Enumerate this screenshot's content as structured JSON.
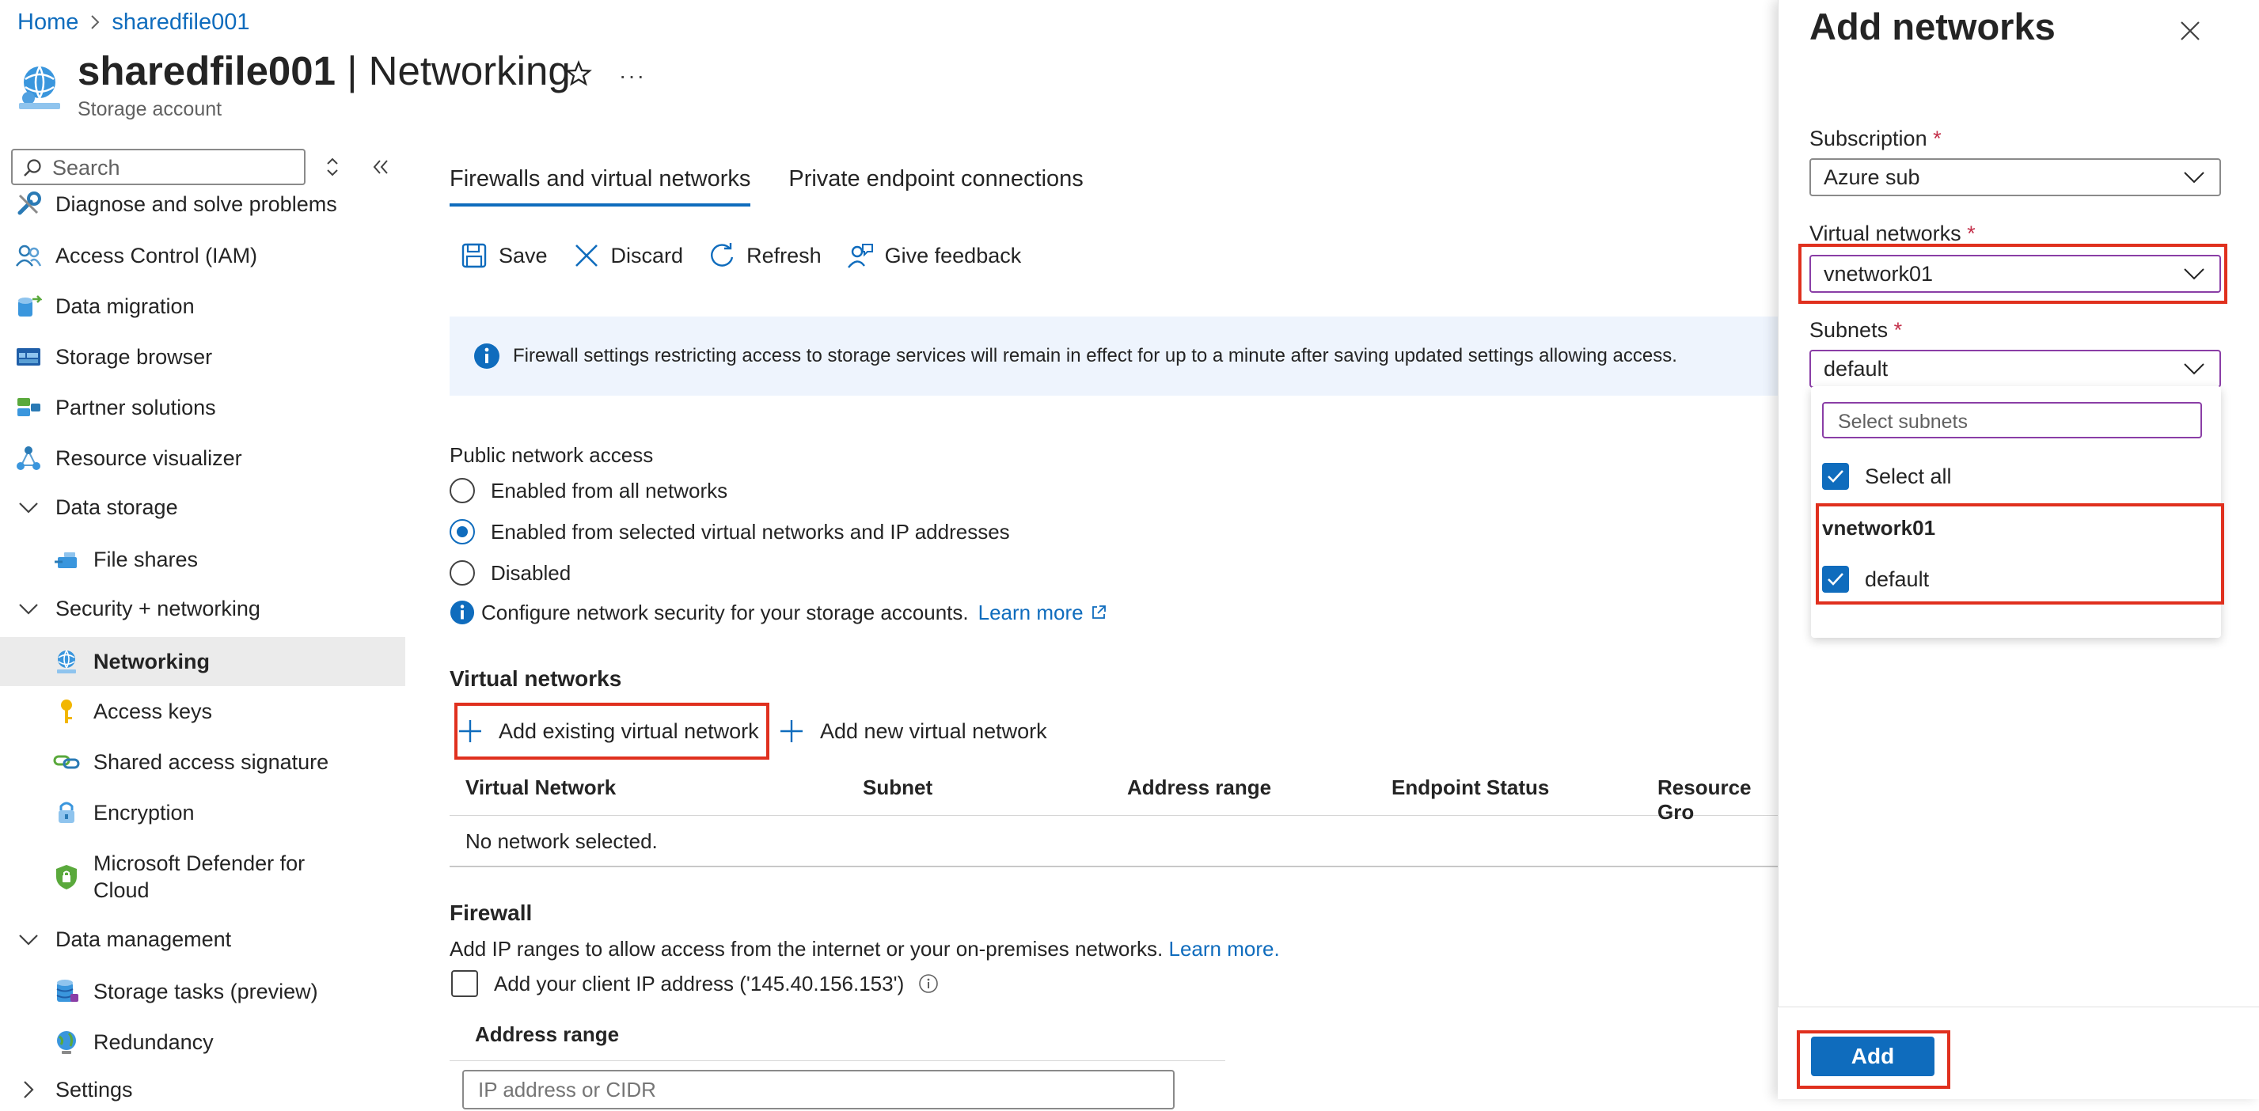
{
  "breadcrumb": {
    "home": "Home",
    "resource": "sharedfile001"
  },
  "header": {
    "resource_name": "sharedfile001",
    "separator": " | ",
    "page": "Networking",
    "subtitle": "Storage account",
    "more": "···"
  },
  "sidebar": {
    "search_placeholder": "Search",
    "items": [
      {
        "label": "Diagnose and solve problems",
        "icon": "wrench-icon"
      },
      {
        "label": "Access Control (IAM)",
        "icon": "people-icon"
      },
      {
        "label": "Data migration",
        "icon": "migration-icon"
      },
      {
        "label": "Storage browser",
        "icon": "storage-browser-icon"
      },
      {
        "label": "Partner solutions",
        "icon": "partner-icon"
      },
      {
        "label": "Resource visualizer",
        "icon": "visualizer-icon"
      },
      {
        "label": "Data storage",
        "icon": "chevron-down-icon"
      },
      {
        "label": "File shares",
        "icon": "file-share-icon"
      },
      {
        "label": "Security + networking",
        "icon": "chevron-down-icon"
      },
      {
        "label": "Networking",
        "icon": "networking-icon"
      },
      {
        "label": "Access keys",
        "icon": "key-icon"
      },
      {
        "label": "Shared access signature",
        "icon": "link-icon"
      },
      {
        "label": "Encryption",
        "icon": "lock-icon"
      },
      {
        "label": "Microsoft Defender for Cloud",
        "icon": "shield-icon"
      },
      {
        "label": "Data management",
        "icon": "chevron-down-icon"
      },
      {
        "label": "Storage tasks (preview)",
        "icon": "database-icon"
      },
      {
        "label": "Redundancy",
        "icon": "globe-icon"
      },
      {
        "label": "Settings",
        "icon": "chevron-right-icon"
      }
    ]
  },
  "tabs": [
    "Firewalls and virtual networks",
    "Private endpoint connections"
  ],
  "toolbar": {
    "save": "Save",
    "discard": "Discard",
    "refresh": "Refresh",
    "feedback": "Give feedback"
  },
  "info_text": "Firewall settings restricting access to storage services will remain in effect for up to a minute after saving updated settings allowing access.",
  "public_access": {
    "label": "Public network access",
    "options": [
      "Enabled from all networks",
      "Enabled from selected virtual networks and IP addresses",
      "Disabled"
    ],
    "selected": "Enabled from selected virtual networks and IP addresses",
    "configure_text": "Configure network security for your storage accounts.",
    "learn_more": "Learn more"
  },
  "virtual_networks": {
    "title": "Virtual networks",
    "add_existing": "Add existing virtual network",
    "add_new": "Add new virtual network",
    "columns": [
      "Virtual Network",
      "Subnet",
      "Address range",
      "Endpoint Status",
      "Resource Gro"
    ],
    "empty": "No network selected."
  },
  "firewall": {
    "title": "Firewall",
    "description": "Add IP ranges to allow access from the internet or your on-premises networks.",
    "learn_more": "Learn more.",
    "client_ip": "Add your client IP address ('145.40.156.153')",
    "address_range_label": "Address range",
    "cidr_placeholder": "IP address or CIDR"
  },
  "panel": {
    "title": "Add networks",
    "subscription_label": "Subscription",
    "subscription_value": "Azure sub",
    "vnet_label": "Virtual networks",
    "vnet_value": "vnetwork01",
    "subnets_label": "Subnets",
    "subnets_value": "default",
    "required_marker": "*",
    "subnet_search_placeholder": "Select subnets",
    "select_all": "Select all",
    "group_name": "vnetwork01",
    "group_option": "default",
    "add_button": "Add"
  },
  "colors": {
    "accent": "#0f6cbd",
    "highlight": "#e0301e",
    "focus": "#8a3ea6"
  }
}
